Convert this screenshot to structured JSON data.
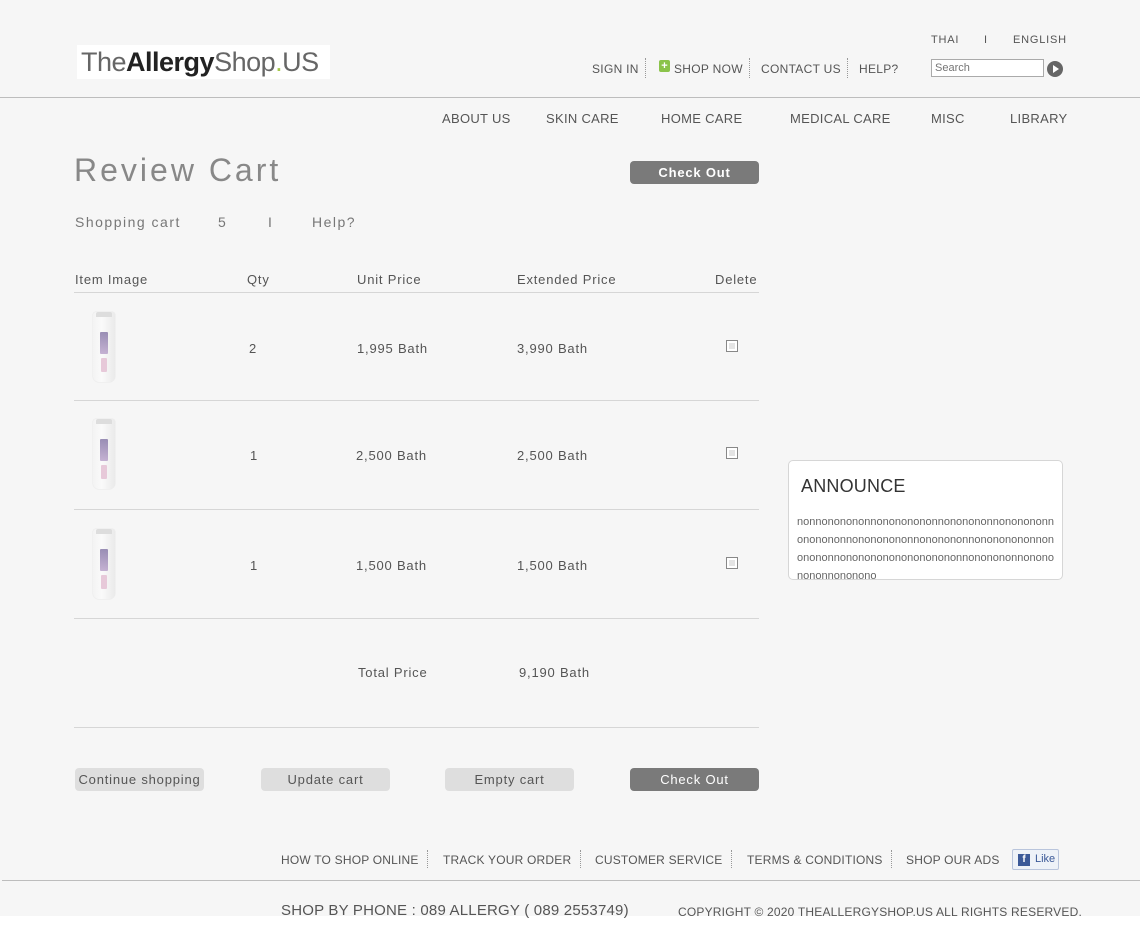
{
  "header": {
    "logo": {
      "part1": "The",
      "part2": "Allergy",
      "part3": "Shop",
      "dot": ".",
      "part4": "US"
    },
    "lang": {
      "thai": "THAI",
      "sep": "I",
      "english": "ENGLISH"
    },
    "topnav": {
      "sign_in": "SIGN IN",
      "shop_now_icon": "+",
      "shop_now": "SHOP NOW",
      "contact": "CONTACT US",
      "help": "HELP?"
    },
    "search": {
      "placeholder": "Search",
      "value": ""
    },
    "mainnav": [
      "ABOUT US",
      "SKIN CARE",
      "HOME CARE",
      "MEDICAL CARE",
      "MISC",
      "LIBRARY"
    ]
  },
  "cart": {
    "title": "Review Cart",
    "checkout_top": "Check Out",
    "info": {
      "label": "Shopping cart",
      "count": "5",
      "sep": "I",
      "help": "Help?"
    },
    "columns": [
      "Item Image",
      "Qty",
      "Unit Price",
      "Extended Price",
      "Delete"
    ],
    "rows": [
      {
        "qty": "2",
        "unit": "1,995 Bath",
        "ext": "3,990 Bath",
        "delete": false
      },
      {
        "qty": "1",
        "unit": "2,500 Bath",
        "ext": "2,500 Bath",
        "delete": false
      },
      {
        "qty": "1",
        "unit": "1,500 Bath",
        "ext": "1,500 Bath",
        "delete": false
      }
    ],
    "total_label": "Total Price",
    "total_value": "9,190 Bath",
    "buttons": {
      "continue": "Continue shopping",
      "update": "Update cart",
      "empty": "Empty cart",
      "checkout": "Check Out"
    }
  },
  "announce": {
    "title": "ANNOUNCE",
    "text": "nonnononononnonononononnononononnononononnononononnonononononnononononnonononononnononononnononononononononononnononononnonononononnononono"
  },
  "footer": {
    "nav": [
      "HOW TO SHOP ONLINE",
      "TRACK YOUR ORDER",
      "CUSTOMER SERVICE",
      "TERMS & CONDITIONS",
      "SHOP OUR ADS"
    ],
    "like": "Like",
    "fb_icon": "f",
    "phone": "SHOP BY PHONE : 089 ALLERGY ( 089 2553749)",
    "copyright": "COPYRIGHT © 2020 THEALLERGYSHOP.US  ALL RIGHTS RESERVED."
  },
  "colors": {
    "accent_green": "#a6c84a",
    "button_dark": "#7a7a7a",
    "button_light": "#dedede",
    "facebook": "#3b5998"
  }
}
